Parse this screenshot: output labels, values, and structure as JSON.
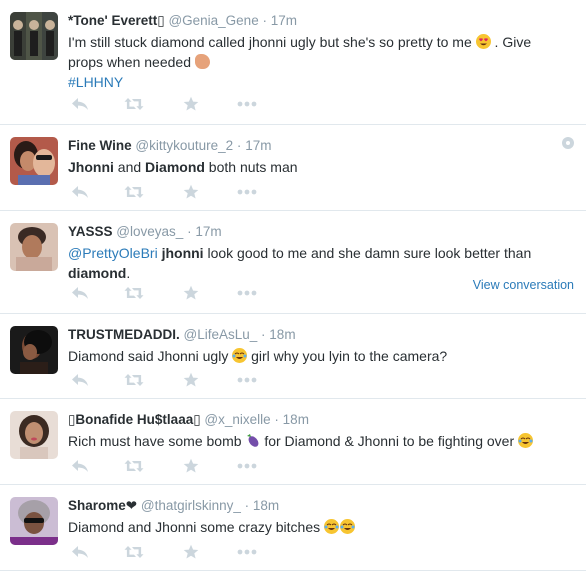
{
  "tweets": [
    {
      "fullname": "*Tone' Everett▯",
      "username": "@Genia_Gene",
      "time": "17m",
      "text1": "I'm still stuck diamond called jhonni ugly but she's so pretty to me",
      "text1b": ". Give",
      "text2": "props when needed",
      "hashtag": "#LHHNY"
    },
    {
      "fullname": "Fine Wine",
      "username": "@kittykouture_2",
      "time": "17m",
      "w1": "Jhonni",
      "w2": " and ",
      "w3": "Diamond",
      "w4": " both nuts man"
    },
    {
      "fullname": "YASSS",
      "username": "@loveyas_",
      "time": "17m",
      "mention": "@PrettyOleBri",
      "w1": "jhonni",
      "w2": " look good to me and she damn sure look better than",
      "w3": "diamond",
      "w4": ".",
      "view_conversation": "View conversation"
    },
    {
      "fullname": "TRUSTMEDADDI.",
      "username": "@LifeAsLu_",
      "time": "18m",
      "text1": "Diamond said Jhonni ugly",
      "text2": "girl why you lyin to the camera?"
    },
    {
      "fullname": "▯Bonafide Hu$tlaaa▯",
      "username": "@x_nixelle",
      "time": "18m",
      "text1": "Rich must have some bomb",
      "text2": "for Diamond & Jhonni to be fighting over"
    },
    {
      "fullname": "Sharome❤",
      "username": "@thatgirlskinny_",
      "time": "18m",
      "text1": "Diamond and Jhonni some crazy bitches"
    }
  ],
  "separator": "·",
  "icons": {
    "reply": "reply-icon",
    "retweet": "retweet-icon",
    "favorite": "star-icon",
    "more": "more-icon",
    "gear": "gear-icon"
  },
  "colors": {
    "text": "#292f33",
    "muted": "#8899a6",
    "link": "#2b7bb9",
    "icon": "#ccd6dd",
    "divider": "#e1e8ed"
  }
}
